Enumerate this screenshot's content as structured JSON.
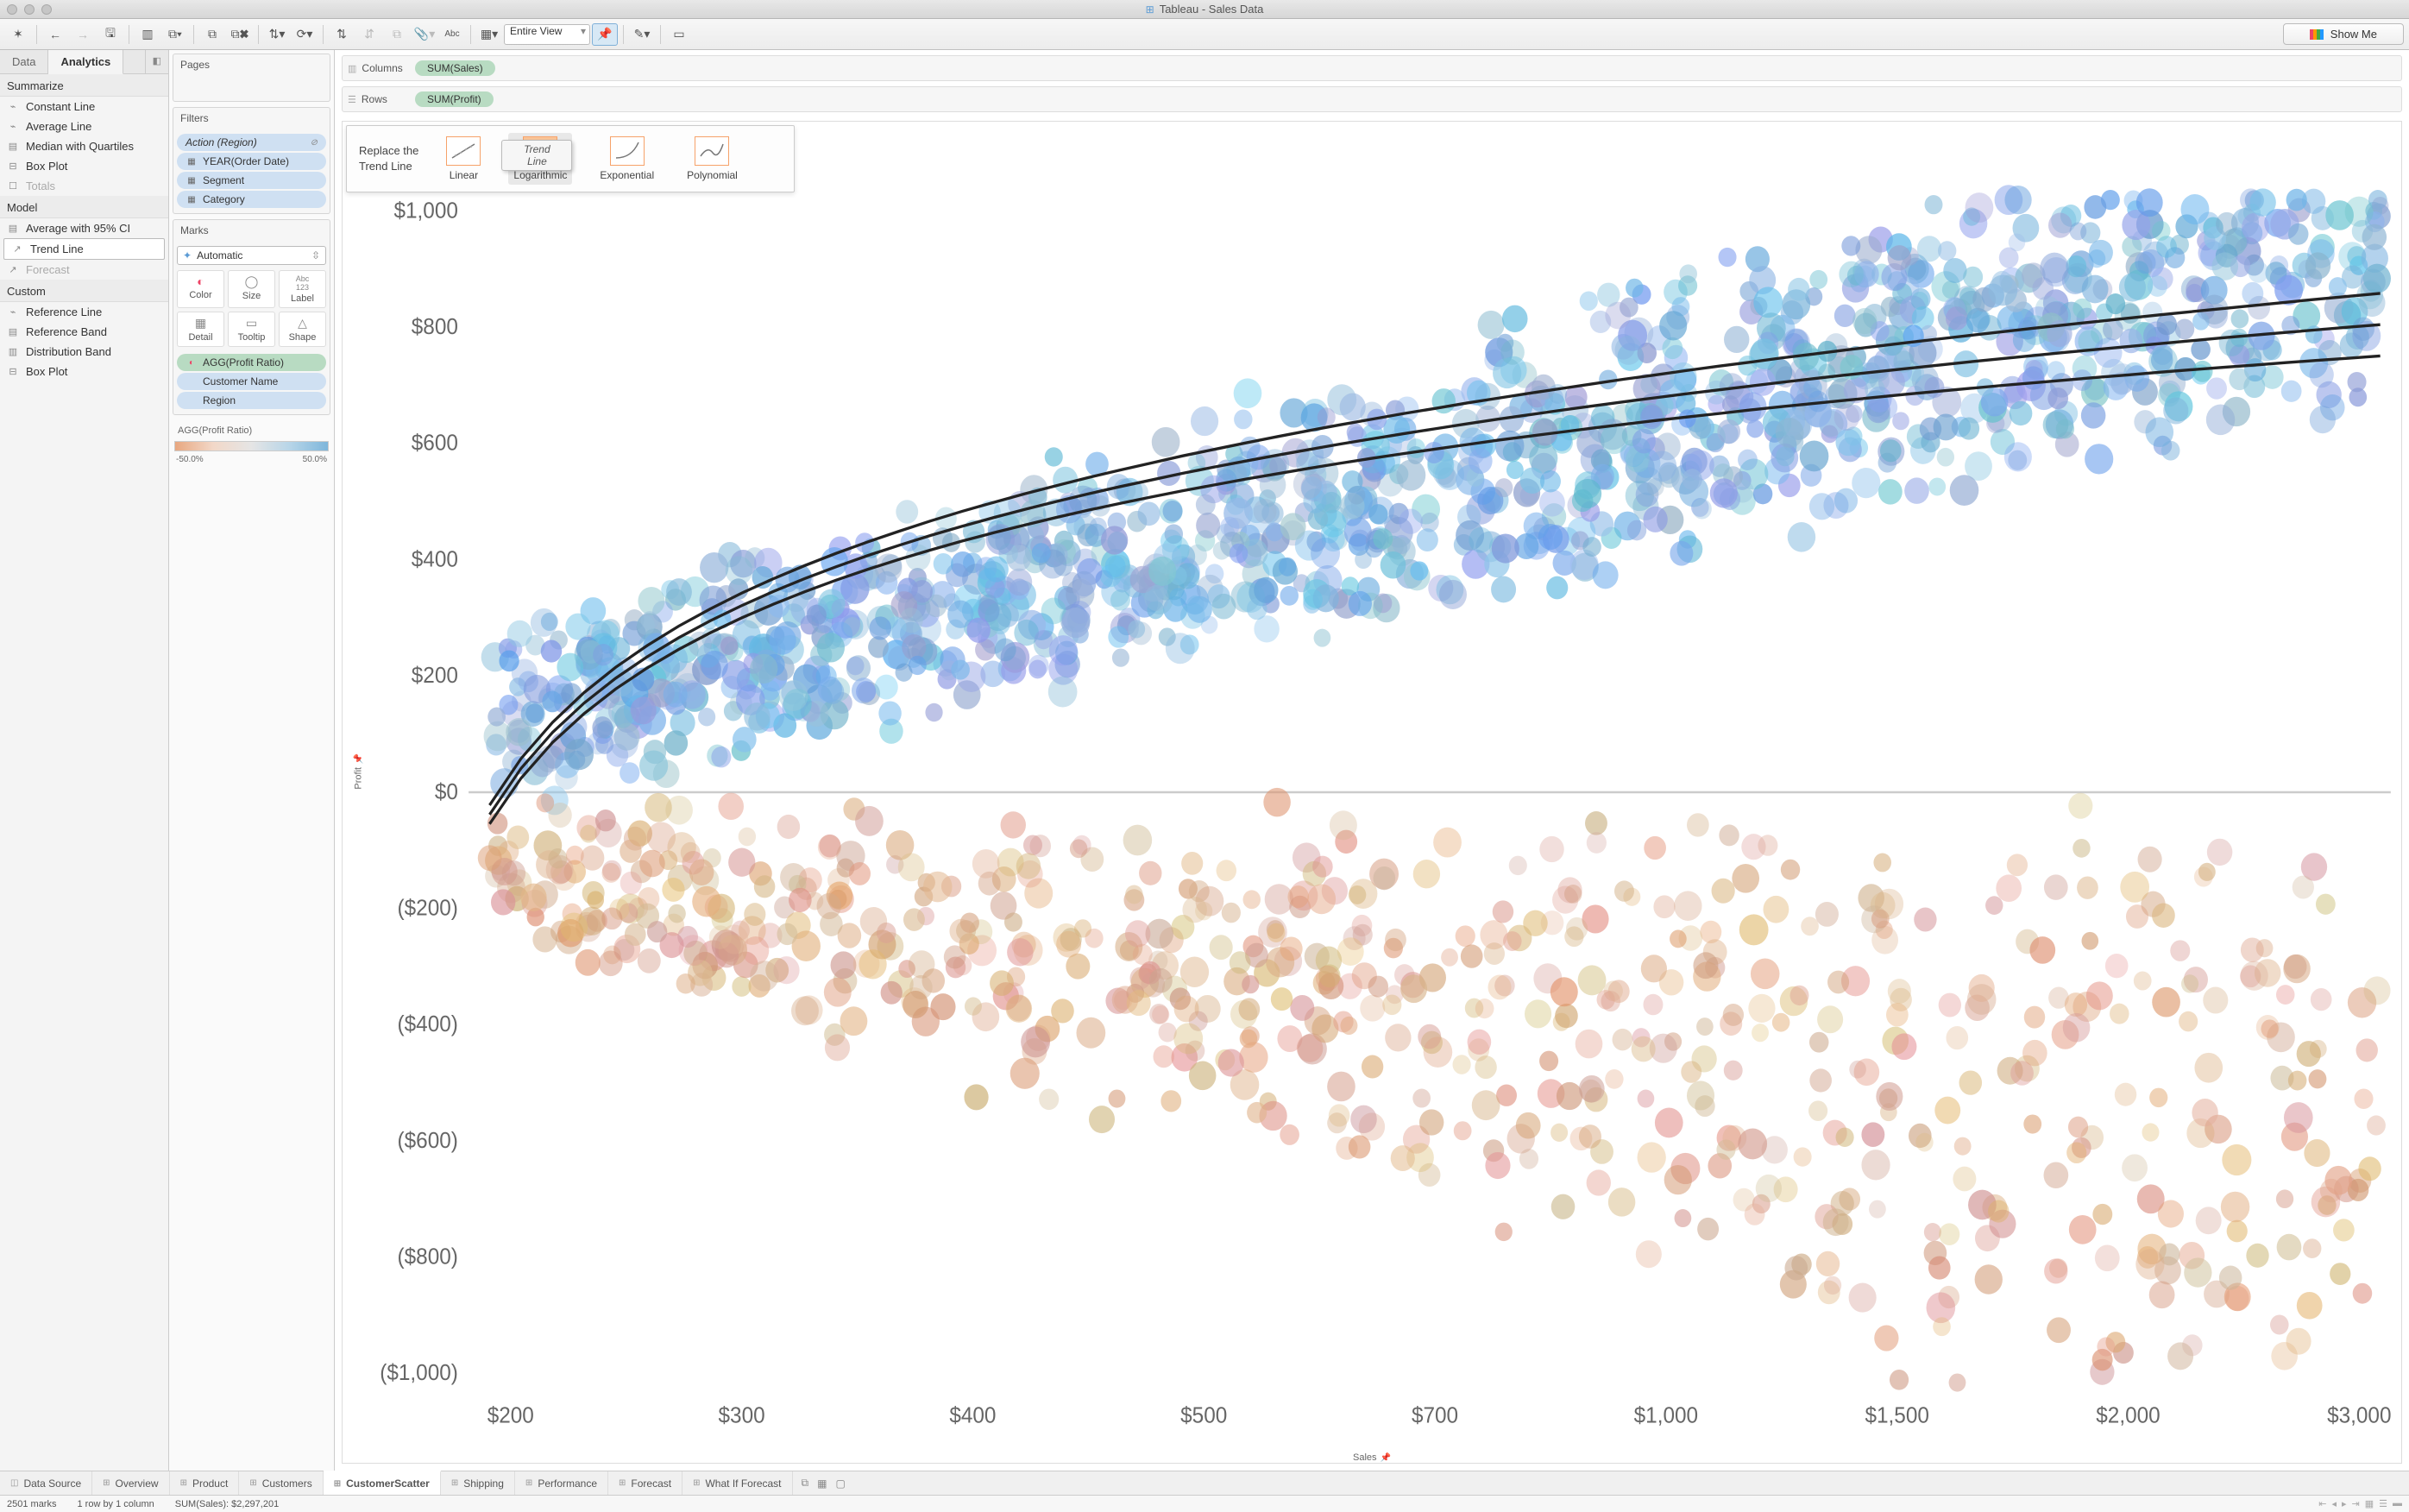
{
  "window": {
    "title": "Tableau - Sales Data"
  },
  "toolbar": {
    "fit_select": "Entire View",
    "show_me": "Show Me"
  },
  "left": {
    "tabs": {
      "data": "Data",
      "analytics": "Analytics"
    },
    "summarize": {
      "title": "Summarize",
      "items": [
        "Constant Line",
        "Average Line",
        "Median with Quartiles",
        "Box Plot",
        "Totals"
      ]
    },
    "model": {
      "title": "Model",
      "items": [
        "Average with 95% CI",
        "Trend Line",
        "Forecast"
      ],
      "selected": "Trend Line"
    },
    "custom": {
      "title": "Custom",
      "items": [
        "Reference Line",
        "Reference Band",
        "Distribution Band",
        "Box Plot"
      ]
    }
  },
  "cards": {
    "pages": {
      "title": "Pages"
    },
    "filters": {
      "title": "Filters",
      "items": [
        {
          "label": "Action (Region)",
          "italic": true,
          "end_icon": "⊘"
        },
        {
          "label": "YEAR(Order Date)",
          "icon": "▦"
        },
        {
          "label": "Segment",
          "icon": "▦"
        },
        {
          "label": "Category",
          "icon": "▦"
        }
      ]
    },
    "marks": {
      "title": "Marks",
      "type_label": "Automatic",
      "cells": [
        "Color",
        "Size",
        "Label",
        "Detail",
        "Tooltip",
        "Shape"
      ],
      "shelf_items": [
        {
          "label": "AGG(Profit Ratio)",
          "color": "green",
          "icon": "●"
        },
        {
          "label": "Customer Name",
          "color": "blue"
        },
        {
          "label": "Region",
          "color": "blue"
        }
      ]
    },
    "legend": {
      "title": "AGG(Profit Ratio)",
      "min": "-50.0%",
      "max": "50.0%"
    }
  },
  "shelves": {
    "columns": {
      "label": "Columns",
      "pill": "SUM(Sales)"
    },
    "rows": {
      "label": "Rows",
      "pill": "SUM(Profit)"
    }
  },
  "trend_popup": {
    "line1": "Replace the",
    "line2": "Trend Line",
    "options": [
      "Linear",
      "Logarithmic",
      "Exponential",
      "Polynomial"
    ],
    "drag_label": "Trend Line"
  },
  "tabs": {
    "data_source": "Data Source",
    "sheets": [
      "Overview",
      "Product",
      "Customers",
      "CustomerScatter",
      "Shipping",
      "Performance",
      "Forecast",
      "What If Forecast"
    ],
    "active": "CustomerScatter"
  },
  "status": {
    "marks": "2501 marks",
    "rowcol": "1 row by 1 column",
    "sum": "SUM(Sales): $2,297,201"
  },
  "chart_data": {
    "type": "scatter",
    "xlabel": "Sales",
    "ylabel": "Profit",
    "x_scale": "log",
    "x_ticks": [
      "$200",
      "$300",
      "$400",
      "$500",
      "$700",
      "$1,000",
      "$1,500",
      "$2,000",
      "$3,000"
    ],
    "y_ticks": [
      "$1,000",
      "$800",
      "$600",
      "$400",
      "$200",
      "$0",
      "($200)",
      "($400)",
      "($600)",
      "($800)",
      "($1,000)"
    ],
    "ylim": [
      -1100,
      1100
    ],
    "series": [
      {
        "name": "positive profit ratio",
        "color": "#6ea8cf",
        "approx_count": 1600
      },
      {
        "name": "negative profit ratio",
        "color": "#dba685",
        "approx_count": 900
      }
    ],
    "trend": {
      "model": "logarithmic",
      "bands": true
    },
    "note": "Dense cloud: each point is a customer; x=SUM(Sales) (log axis, ~150 to ~4000), y=SUM(Profit) (~ -1100 to ~1100). Color diverging by AGG(Profit Ratio) from -50% (orange) to +50% (blue). Three black logarithmic trend curves (center + confidence bands) rising from ~($50,$50) to ~($4000,$600). Zero-profit horizontal gridline shown."
  }
}
